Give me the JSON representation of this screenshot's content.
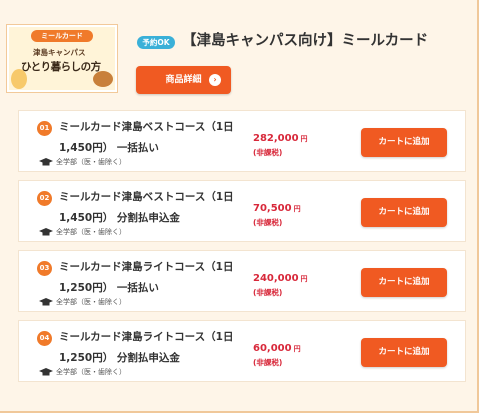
{
  "product": {
    "thumbnail": {
      "pill": "ミールカード",
      "line1": "津島キャンパス",
      "line2": "ひとり暮らしの方"
    },
    "badge": "予約OK",
    "title": "【津島キャンパス向け】ミールカード",
    "detail_button": "商品詳細",
    "detail_arrow": "›"
  },
  "courses": [
    {
      "num": "01",
      "name": "ミールカード津島ベストコース（1日1,450円） 一括払い",
      "target": "全学部（医・歯除く）",
      "price": "282,000",
      "yen": "円",
      "tax": "(非課税)",
      "cart": "カートに追加"
    },
    {
      "num": "02",
      "name": "ミールカード津島ベストコース（1日1,450円） 分割払申込金",
      "target": "全学部（医・歯除く）",
      "price": "70,500",
      "yen": "円",
      "tax": "(非課税)",
      "cart": "カートに追加"
    },
    {
      "num": "03",
      "name": "ミールカード津島ライトコース（1日1,250円） 一括払い",
      "target": "全学部（医・歯除く）",
      "price": "240,000",
      "yen": "円",
      "tax": "(非課税)",
      "cart": "カートに追加"
    },
    {
      "num": "04",
      "name": "ミールカード津島ライトコース（1日1,250円） 分割払申込金",
      "target": "全学部（医・歯除く）",
      "price": "60,000",
      "yen": "円",
      "tax": "(非課税)",
      "cart": "カートに追加"
    }
  ],
  "colors": {
    "accent": "#f05a22",
    "price": "#d8283a",
    "badge": "#3ab0d8",
    "background": "#fef5e8"
  }
}
